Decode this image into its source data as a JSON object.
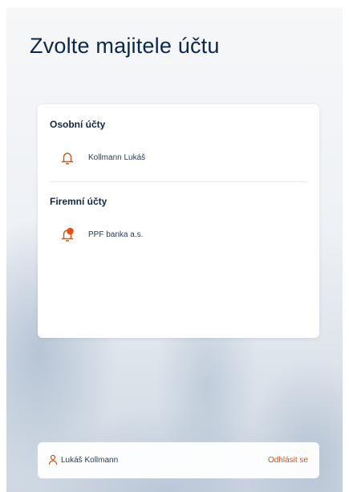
{
  "page": {
    "title": "Zvolte majitele účtu"
  },
  "personal": {
    "heading": "Osobní účty",
    "accounts": [
      {
        "name": "Kollmann Lukáš",
        "icon": "bell-icon",
        "has_notification": false
      }
    ]
  },
  "business": {
    "heading": "Firemní účty",
    "accounts": [
      {
        "name": "PPF banka a.s.",
        "icon": "bell-icon",
        "has_notification": true
      }
    ]
  },
  "footer": {
    "user_name": "Lukáš Kollmann",
    "user_icon": "user-icon",
    "logout_label": "Odhlásit se"
  },
  "colors": {
    "title": "#0e2847",
    "accent": "#c9551b",
    "notification_dot": "#e8500f"
  }
}
